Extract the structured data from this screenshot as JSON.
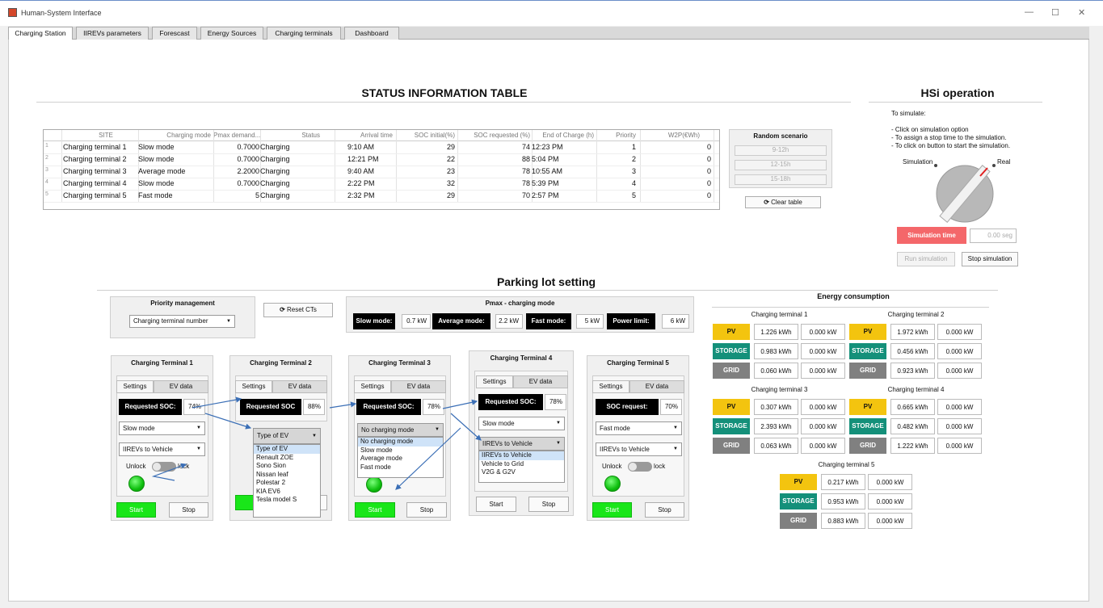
{
  "window": {
    "title": "Human-System Interface",
    "min": "—",
    "max": "☐",
    "close": "✕"
  },
  "tabs": [
    "Charging Station",
    "IIREVs parameters",
    "Forescast",
    "Energy Sources",
    "Charging terminals",
    "Dashboard"
  ],
  "status": {
    "title": "STATUS INFORMATION  TABLE",
    "columns": [
      "SITE",
      "Charging mode",
      "Pmax demand...",
      "Status",
      "Arrival time",
      "SOC initial(%)",
      "SOC requested (%)",
      "End of Charge (h)",
      "Priority",
      "W2P(€Wh)"
    ],
    "rows": [
      {
        "n": "1",
        "site": "Charging terminal 1",
        "mode": "Slow mode",
        "pmax": "0.7000",
        "status": "Charging",
        "arr": "9:10 AM",
        "soci": "29",
        "socr": "74",
        "eoc": "12:23 PM",
        "pri": "1",
        "w2p": "0"
      },
      {
        "n": "2",
        "site": "Charging terminal 2",
        "mode": "Slow mode",
        "pmax": "0.7000",
        "status": "Charging",
        "arr": "12:21 PM",
        "soci": "22",
        "socr": "88",
        "eoc": "5:04 PM",
        "pri": "2",
        "w2p": "0"
      },
      {
        "n": "3",
        "site": "Charging terminal 3",
        "mode": "Average mode",
        "pmax": "2.2000",
        "status": "Charging",
        "arr": "9:40 AM",
        "soci": "23",
        "socr": "78",
        "eoc": "10:55 AM",
        "pri": "3",
        "w2p": "0"
      },
      {
        "n": "4",
        "site": "Charging terminal 4",
        "mode": "Slow mode",
        "pmax": "0.7000",
        "status": "Charging",
        "arr": "2:22 PM",
        "soci": "32",
        "socr": "78",
        "eoc": "5:39 PM",
        "pri": "4",
        "w2p": "0"
      },
      {
        "n": "5",
        "site": "Charging terminal 5",
        "mode": "Fast mode",
        "pmax": "5",
        "status": "Charging",
        "arr": "2:32 PM",
        "soci": "29",
        "socr": "70",
        "eoc": "2:57 PM",
        "pri": "5",
        "w2p": "0"
      }
    ]
  },
  "random": {
    "title": "Random scenario",
    "b1": "9-12h",
    "b2": "12-15h",
    "b3": "15-18h",
    "clear": "Clear table"
  },
  "hsi": {
    "title": "HSi operation",
    "to_sim": "To simulate:",
    "i1": "- Click on simulation option",
    "i2": "- To assign a stop time to the simulation.",
    "i3": "- To click on button to start the simulation.",
    "simulation": "Simulation",
    "real": "Real",
    "sim_time": "Simulation time",
    "sim_val": "0.00 seg",
    "run": "Run simulation",
    "stop": "Stop simulation"
  },
  "parking": {
    "title": "Parking lot setting"
  },
  "priority": {
    "title": "Priority management",
    "value": "Charging terminal number",
    "reset": "Reset CTs"
  },
  "pmax": {
    "title": "Pmax - charging mode",
    "slow": "Slow mode:",
    "slow_v": "0.7 kW",
    "avg": "Average mode:",
    "avg_v": "2.2 kW",
    "fast": "Fast mode:",
    "fast_v": "5 kW",
    "limit": "Power limit:",
    "limit_v": "6 kW"
  },
  "tabs_ct": {
    "settings": "Settings",
    "ev": "EV data",
    "start": "Start",
    "stop": "Stop",
    "unlock": "Unlock",
    "lock": "lock"
  },
  "ct1": {
    "title": "Charging Terminal 1",
    "soc_lbl": "Requested SOC:",
    "soc": "74%",
    "mode": "Slow mode",
    "flow": "IIREVs to Vehicle"
  },
  "ct2": {
    "title": "Charging Terminal 2",
    "soc_lbl": "Requested SOC",
    "soc": "88%",
    "ev": "Type of EV",
    "list": [
      "Type of EV",
      "Renault ZOE",
      "Sono Sion",
      "Nissan leaf",
      "Polestar 2",
      "KIA EV6",
      "Tesla model S"
    ]
  },
  "ct3": {
    "title": "Charging Terminal 3",
    "soc_lbl": "Requested SOC:",
    "soc": "78%",
    "mode": "No charging mode",
    "list": [
      "No charging mode",
      "Slow mode",
      "Average mode",
      "Fast mode"
    ]
  },
  "ct4": {
    "title": "Charging Terminal 4",
    "soc_lbl": "Requested SOC:",
    "soc": "78%",
    "mode": "Slow mode",
    "flow": "IIREVs to Vehicle",
    "list": [
      "IIREVs to Vehicle",
      "Vehicle to Grid",
      "V2G & G2V"
    ]
  },
  "ct5": {
    "title": "Charging Terminal 5",
    "soc_lbl": "SOC request:",
    "soc": "70%",
    "mode": "Fast mode",
    "flow": "IIREVs to Vehicle"
  },
  "energy": {
    "title": "Energy consumption",
    "pv": "PV",
    "storage": "STORAGE",
    "grid": "GRID",
    "t1": {
      "name": "Charging terminal 1",
      "pv": "1.226 kWh",
      "pv2": "0.000 kW",
      "st": "0.983 kWh",
      "st2": "0.000 kW",
      "gr": "0.060 kWh",
      "gr2": "0.000 kW"
    },
    "t2": {
      "name": "Charging terminal 2",
      "pv": "1.972 kWh",
      "pv2": "0.000 kW",
      "st": "0.456 kWh",
      "st2": "0.000 kW",
      "gr": "0.923 kWh",
      "gr2": "0.000 kW"
    },
    "t3": {
      "name": "Charging terminal 3",
      "pv": "0.307 kWh",
      "pv2": "0.000 kW",
      "st": "2.393 kWh",
      "st2": "0.000 kW",
      "gr": "0.063 kWh",
      "gr2": "0.000 kW"
    },
    "t4": {
      "name": "Charging terminal 4",
      "pv": "0.665 kWh",
      "pv2": "0.000 kW",
      "st": "0.482 kWh",
      "st2": "0.000 kW",
      "gr": "1.222 kWh",
      "gr2": "0.000 kW"
    },
    "t5": {
      "name": "Charging terminal 5",
      "pv": "0.217 kWh",
      "pv2": "0.000 kW",
      "st": "0.953 kWh",
      "st2": "0.000 kW",
      "gr": "0.883 kWh",
      "gr2": "0.000 kW"
    }
  }
}
